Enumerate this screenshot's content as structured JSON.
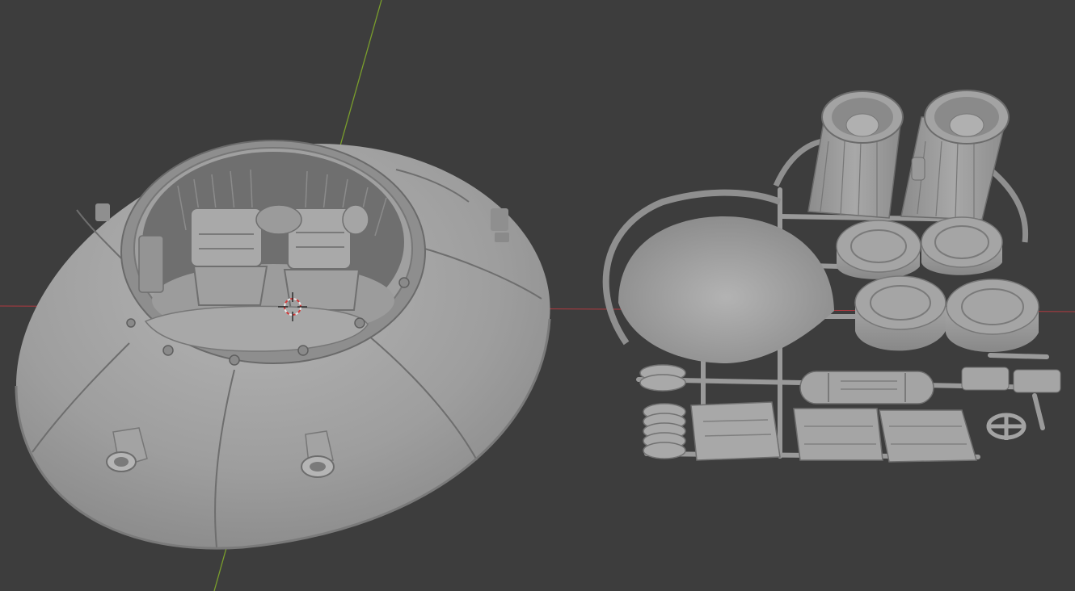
{
  "viewport": {
    "background": "#3d3d3d",
    "axis_x_color": "#b03a40",
    "axis_y_color": "#7a9e2c",
    "model_color": "#9a9a9a"
  },
  "objects": {
    "saucer": "saucer-body",
    "parts_sprue": "parts-sprue",
    "cursor": "3d-cursor-icon"
  }
}
